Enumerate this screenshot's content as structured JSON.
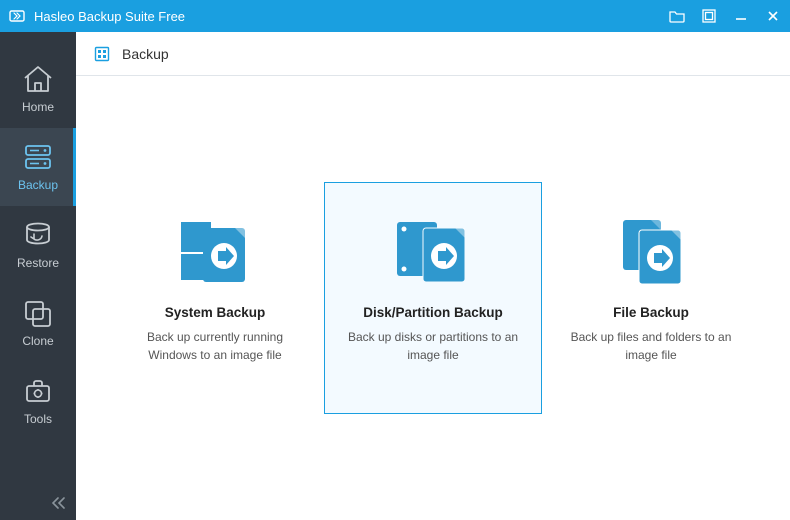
{
  "app": {
    "title": "Hasleo Backup Suite Free"
  },
  "sidebar": {
    "items": [
      {
        "label": "Home"
      },
      {
        "label": "Backup"
      },
      {
        "label": "Restore"
      },
      {
        "label": "Clone"
      },
      {
        "label": "Tools"
      }
    ]
  },
  "breadcrumb": {
    "label": "Backup"
  },
  "cards": [
    {
      "title": "System Backup",
      "desc": "Back up currently running Windows to an image file"
    },
    {
      "title": "Disk/Partition Backup",
      "desc": "Back up disks or partitions to an image file"
    },
    {
      "title": "File Backup",
      "desc": "Back up files and folders to an image file"
    }
  ]
}
